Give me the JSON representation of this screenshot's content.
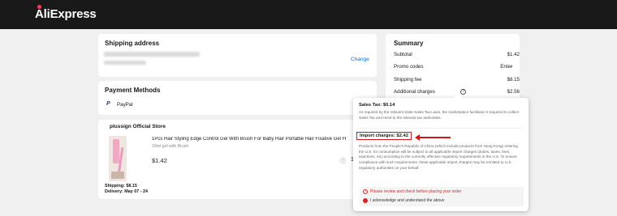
{
  "header": {
    "logo_text": "AliExpress"
  },
  "shipping_address": {
    "title": "Shipping address",
    "change_label": "Change"
  },
  "payment": {
    "title": "Payment Methods",
    "method": "PayPal"
  },
  "store": {
    "name": "plussign Official Store",
    "product_title": "1Pcs Hair Styling Edge Control Gel With Brush For Baby Hair Portable Hair Fixative Gel H",
    "product_variant": "10ml gel with Brush",
    "price": "$1.42",
    "quantity": "1",
    "shipping": "Shipping: $8.15",
    "delivery": "Delivery: May 07 - 24"
  },
  "summary": {
    "title": "Summary",
    "rows": [
      {
        "label": "Subtotal",
        "value": "$1.42"
      },
      {
        "label": "Promo codes",
        "value": "Enter"
      },
      {
        "label": "Shipping fee",
        "value": "$8.15"
      },
      {
        "label": "Additional charges",
        "value": "$2.56"
      }
    ]
  },
  "tooltip": {
    "sales_tax_title": "Sales Tax: $0.14",
    "sales_tax_text": "As required by the relevant State Sales Tax Laws, the marketplace facilitator is required to collect Sales Tax and remit to the relevant tax authorities.",
    "import_title": "Import charges: $2.42",
    "import_text": "Products from the People's Republic of China (which include products from Hong Kong) entering the U.S. for consumption will be subject to all applicable import charges (duties, taxes, fees, exactions, etc) according to the currently effective regulatory requirements in the U.S. To ensure compliance with such requirements, these applicable import charges may be remitted to U.S. regulatory authorities on your behalf.",
    "warning": "Please review and check before placing your order",
    "acknowledge": "I acknowledge and understand the above"
  },
  "colors": {
    "accent_red": "#e02020",
    "link_blue": "#1769c9",
    "topbar": "#191919"
  }
}
